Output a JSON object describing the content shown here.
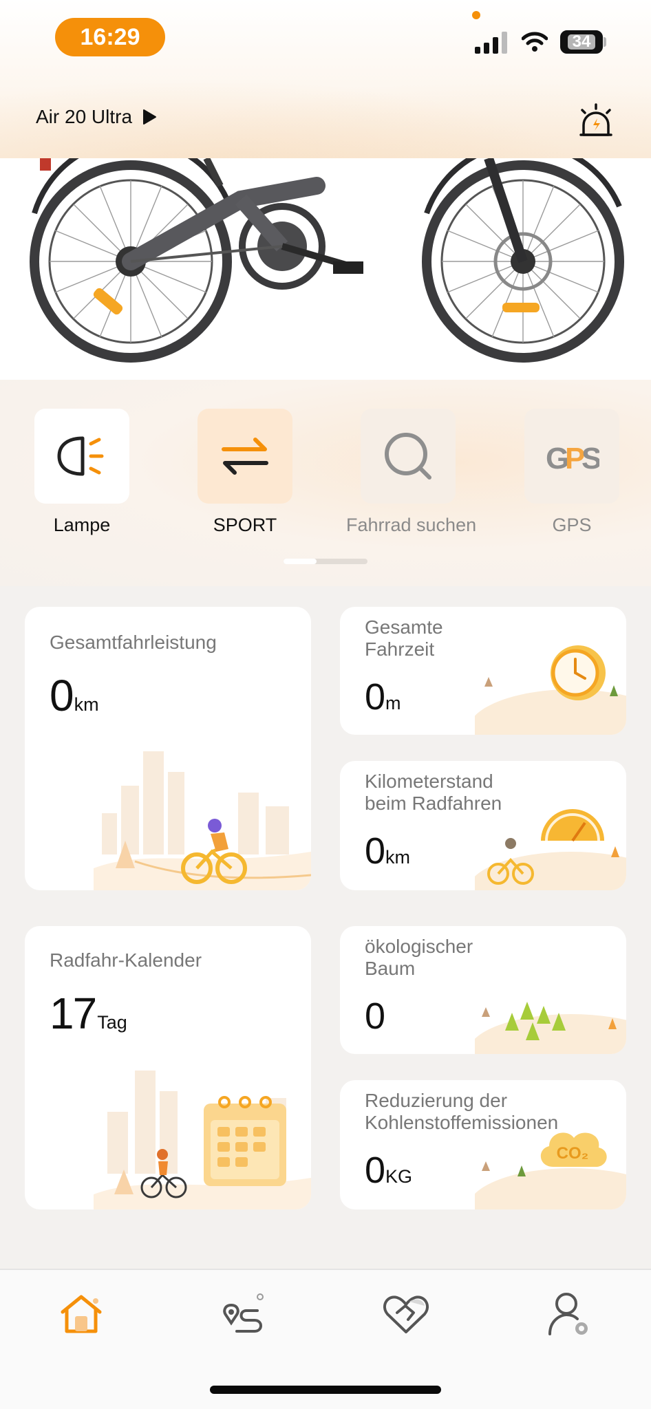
{
  "status_bar": {
    "time": "16:29",
    "battery": "34"
  },
  "header": {
    "bike_name": "Air 20 Ultra"
  },
  "quick_actions": [
    {
      "label": "Lampe",
      "icon": "headlight-icon",
      "state": "normal"
    },
    {
      "label": "SPORT",
      "icon": "mode-switch-icon",
      "state": "active"
    },
    {
      "label": "Fahrrad suchen",
      "icon": "search-icon",
      "state": "muted"
    },
    {
      "label": "GPS",
      "icon": "gps-icon",
      "state": "muted"
    }
  ],
  "stats": {
    "total_distance": {
      "title": "Gesamtfahrleistung",
      "value": "0",
      "unit": "km"
    },
    "total_time": {
      "title_line1": "Gesamte",
      "title_line2": "Fahrzeit",
      "value": "0",
      "unit": "m"
    },
    "odometer": {
      "title_line1": "Kilometerstand",
      "title_line2": "beim Radfahren",
      "value": "0",
      "unit": "km"
    },
    "calendar": {
      "title": "Radfahr-Kalender",
      "value": "17",
      "unit": "Tag"
    },
    "eco_tree": {
      "title_line1": "ökologischer",
      "title_line2": "Baum",
      "value": "0",
      "unit": ""
    },
    "carbon": {
      "title_line1": "Reduzierung der",
      "title_line2": "Kohlenstoffemissionen",
      "value": "0",
      "unit": "KG",
      "badge": "CO₂"
    }
  },
  "bottom_nav": [
    {
      "name": "home",
      "icon": "home-icon",
      "active": true
    },
    {
      "name": "routes",
      "icon": "route-icon",
      "active": false
    },
    {
      "name": "care",
      "icon": "heart-hands-icon",
      "active": false
    },
    {
      "name": "profile",
      "icon": "profile-settings-icon",
      "active": false
    }
  ],
  "colors": {
    "accent": "#f5900a",
    "background": "#f3f1ef",
    "card": "#ffffff",
    "muted_text": "#777777"
  }
}
